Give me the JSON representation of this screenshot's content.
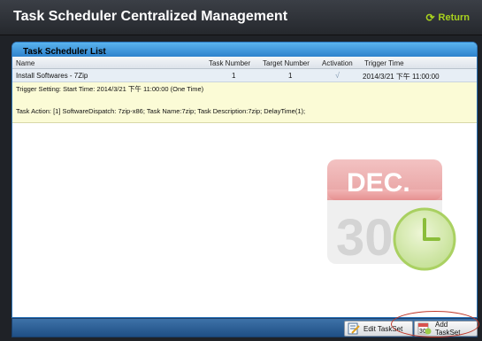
{
  "app": {
    "title": "Task Scheduler Centralized Management",
    "return_label": "Return",
    "return_icon": "refresh-arrow-icon",
    "accent_color": "#a8d21e"
  },
  "panel": {
    "title": "Task Scheduler List",
    "columns": [
      "Name",
      "Task Number",
      "Target Number",
      "Activation",
      "Trigger Time"
    ],
    "rows": [
      {
        "name": "Install Softwares - 7Zip",
        "task_number": "1",
        "target_number": "1",
        "activation": "√",
        "trigger_time": "2014/3/21 下午 11:00:00",
        "trigger_setting": "Trigger Setting: Start Time: 2014/3/21 下午 11:00:00 (One Time)",
        "task_action": "Task Action: [1] SoftwareDispatch: 7zip-x86; Task Name:7zip; Task Description:7zip; DelayTime(1);"
      }
    ],
    "header_color": "#3a93dd",
    "detail_color": "#fbfbd6"
  },
  "calendar_graphic": {
    "month": "DEC.",
    "day": "30",
    "icon": "calendar-clock-icon"
  },
  "footer": {
    "edit_label": "Edit TaskSet",
    "edit_icon": "edit-document-icon",
    "add_label": "Add TaskSet",
    "add_icon": "add-calendar-icon"
  }
}
